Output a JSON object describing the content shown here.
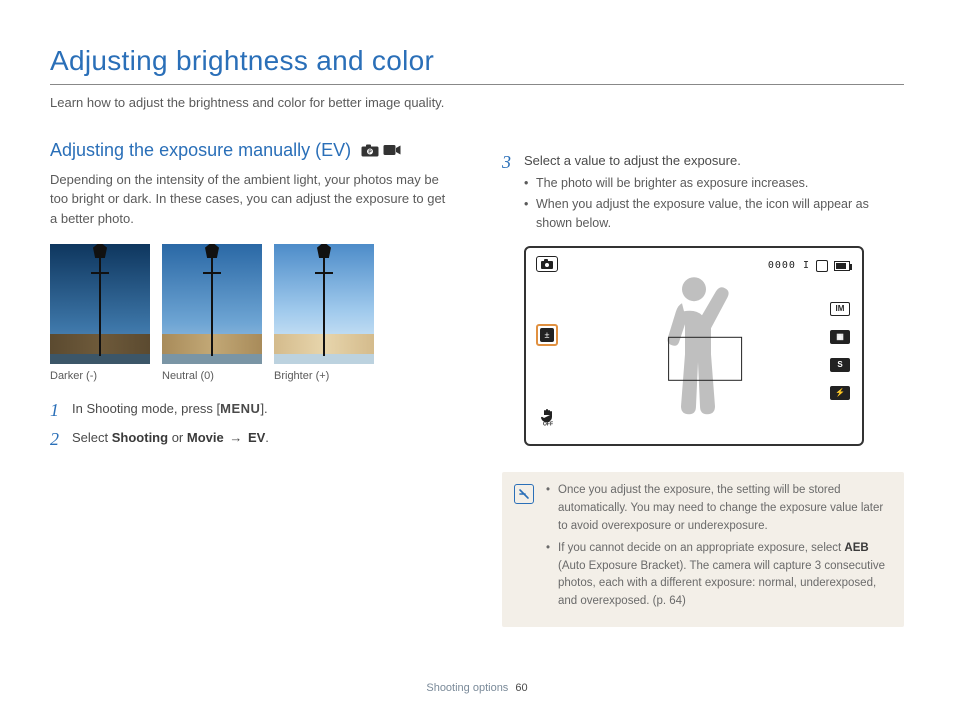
{
  "title": "Adjusting brightness and color",
  "intro": "Learn how to adjust the brightness and color for better image quality.",
  "left": {
    "subheading": "Adjusting the exposure manually (EV)",
    "mode_icons": [
      "camera-p-icon",
      "movie-icon"
    ],
    "body": "Depending on the intensity of the ambient light, your photos may be too bright or dark. In these cases, you can adjust the exposure to get a better photo.",
    "thumbs": [
      {
        "label": "Darker (-)"
      },
      {
        "label": "Neutral (0)"
      },
      {
        "label": "Brighter (+)"
      }
    ],
    "steps": {
      "s1_a": "In Shooting mode, press [",
      "s1_menu": "MENU",
      "s1_b": "].",
      "s2_a": "Select ",
      "s2_shoot": "Shooting",
      "s2_or": " or ",
      "s2_movie": "Movie",
      "s2_arrow": " → ",
      "s2_ev": "EV",
      "s2_end": "."
    }
  },
  "right": {
    "step3": "Select a value to adjust the exposure.",
    "bullets": [
      "The photo will be brighter as exposure increases.",
      "When you adjust the exposure value, the icon will appear as shown below."
    ],
    "viewfinder": {
      "counter": "0000 I",
      "ev_label": "±",
      "hand_off": "✋",
      "right_icons": [
        "IM",
        "▦",
        "S",
        "⚡"
      ]
    },
    "note": {
      "n1_a": "Once you adjust the exposure, the setting will be stored automatically. You may need to change the exposure value later to avoid overexposure or underexposure.",
      "n2_a": "If you cannot decide on an appropriate exposure, select ",
      "n2_aeb": "AEB",
      "n2_b": " (Auto Exposure Bracket). The camera will capture 3 consecutive photos, each with a different exposure: normal, underexposed, and overexposed. (p. 64)"
    }
  },
  "footer": {
    "section": "Shooting options",
    "page": "60"
  }
}
